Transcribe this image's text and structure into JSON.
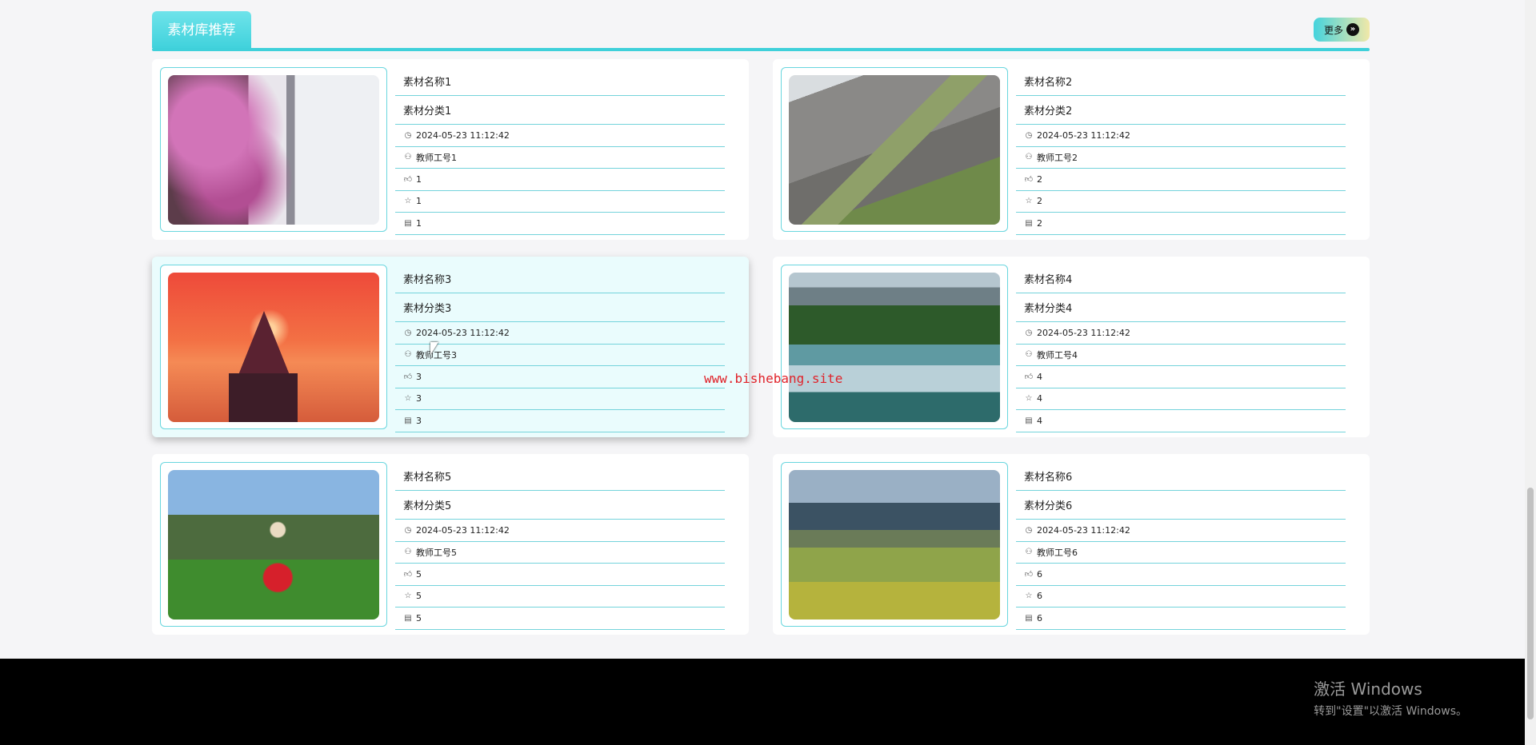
{
  "section": {
    "title": "素材库推荐",
    "more_label": "更多",
    "more_icon": "double-chevron-right-icon",
    "accent_color": "#3fd0da"
  },
  "cards": [
    {
      "name": "素材名称1",
      "category": "素材分类1",
      "time": "2024-05-23 11:12:42",
      "teacher": "教师工号1",
      "likes": "1",
      "favorites": "1",
      "comments": "1"
    },
    {
      "name": "素材名称2",
      "category": "素材分类2",
      "time": "2024-05-23 11:12:42",
      "teacher": "教师工号2",
      "likes": "2",
      "favorites": "2",
      "comments": "2"
    },
    {
      "name": "素材名称3",
      "category": "素材分类3",
      "time": "2024-05-23 11:12:42",
      "teacher": "教师工号3",
      "likes": "3",
      "favorites": "3",
      "comments": "3"
    },
    {
      "name": "素材名称4",
      "category": "素材分类4",
      "time": "2024-05-23 11:12:42",
      "teacher": "教师工号4",
      "likes": "4",
      "favorites": "4",
      "comments": "4"
    },
    {
      "name": "素材名称5",
      "category": "素材分类5",
      "time": "2024-05-23 11:12:42",
      "teacher": "教师工号5",
      "likes": "5",
      "favorites": "5",
      "comments": "5"
    },
    {
      "name": "素材名称6",
      "category": "素材分类6",
      "time": "2024-05-23 11:12:42",
      "teacher": "教师工号6",
      "likes": "6",
      "favorites": "6",
      "comments": "6"
    }
  ],
  "watermark": "www.bishebang.site",
  "windows_activation": {
    "title": "激活 Windows",
    "subtitle": "转到\"设置\"以激活 Windows。"
  }
}
